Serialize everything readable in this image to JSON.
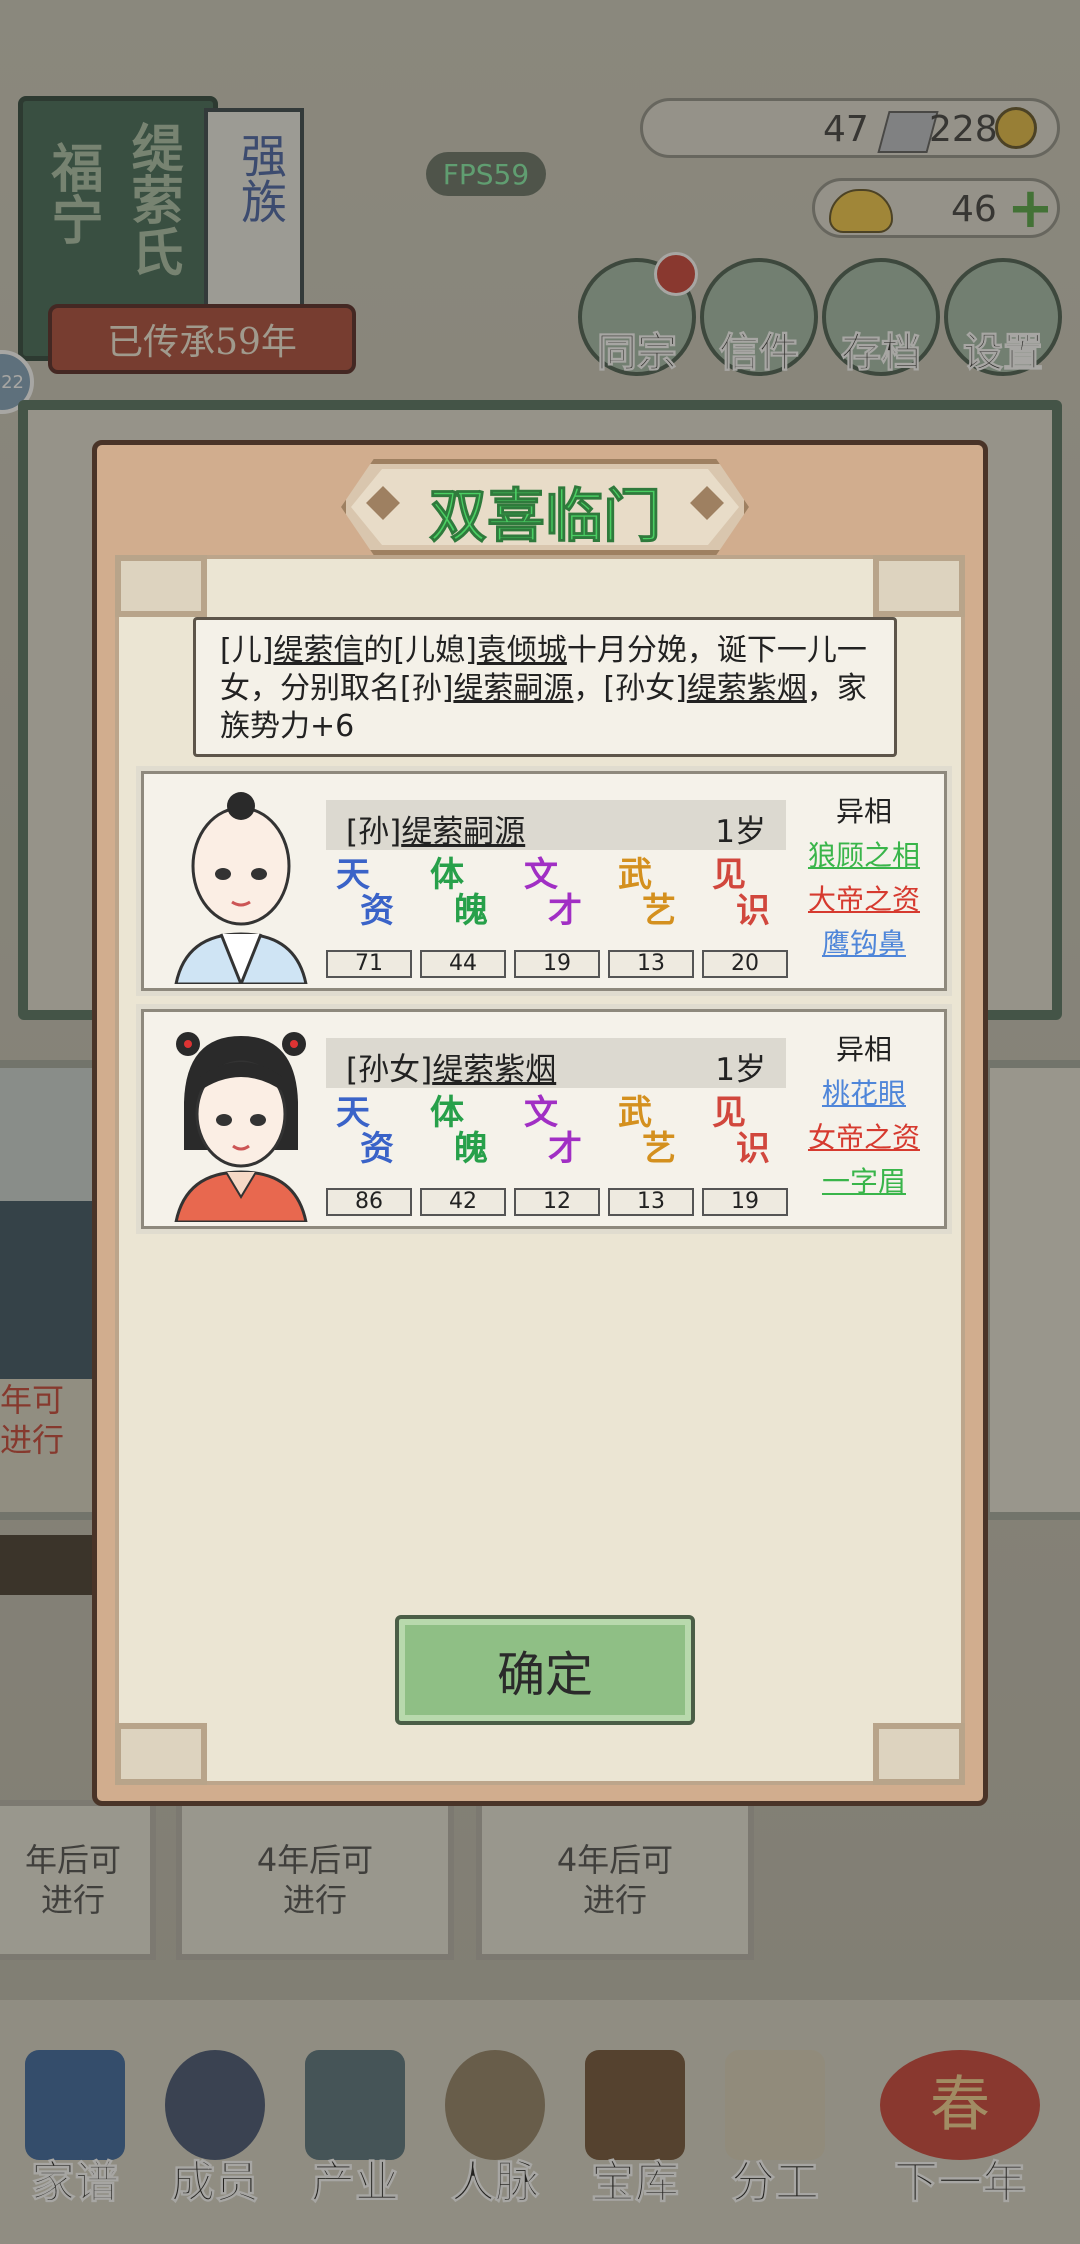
{
  "background": {
    "clan": {
      "book_chars_1": "福宁",
      "book_chars_2": "缇萦氏",
      "side_label": "强族",
      "generations": "已传承59年"
    },
    "avatar_badge": "22",
    "fps": "FPS59",
    "resources": {
      "silver": "47",
      "copper": "228",
      "gold": "46"
    },
    "top_buttons": [
      "同宗",
      "信件",
      "存档",
      "设置"
    ],
    "mid_text": "年可\n进行",
    "lower_cards": [
      "年后可\n进行",
      "4年后可\n进行",
      "4年后可\n进行"
    ],
    "nav": [
      "家谱",
      "成员",
      "产业",
      "人脉",
      "宝库",
      "分工",
      "下一年"
    ],
    "spring_char": "春"
  },
  "modal": {
    "title": "双喜临门",
    "message": {
      "p1": "[儿]",
      "father": "缇萦信",
      "p2": "的[儿媳]",
      "mother": "袁倾城",
      "p3": "十月分娩，诞下一儿一女，分别取名[孙]",
      "son": "缇萦嗣源",
      "p4": "，[孙女]",
      "daughter": "缇萦紫烟",
      "p5": "，家族势力+6"
    },
    "children": [
      {
        "prefix": "[孙]",
        "name": "缇萦嗣源",
        "age": "1岁",
        "stats": [
          {
            "c1": "天",
            "c2": "资",
            "value": "71",
            "color": "#3a63c8"
          },
          {
            "c1": "体",
            "c2": "魄",
            "value": "44",
            "color": "#27a04a"
          },
          {
            "c1": "文",
            "c2": "才",
            "value": "19",
            "color": "#a12fc4"
          },
          {
            "c1": "武",
            "c2": "艺",
            "value": "13",
            "color": "#d4901e"
          },
          {
            "c1": "见",
            "c2": "识",
            "value": "20",
            "color": "#d1473d"
          }
        ],
        "traits_header": "异相",
        "traits": [
          {
            "label": "狼顾之相",
            "color": "#39b54a"
          },
          {
            "label": "大帝之资",
            "color": "#d63a2f"
          },
          {
            "label": "鹰钩鼻",
            "color": "#4f86d9"
          }
        ]
      },
      {
        "prefix": "[孙女]",
        "name": "缇萦紫烟",
        "age": "1岁",
        "stats": [
          {
            "c1": "天",
            "c2": "资",
            "value": "86",
            "color": "#3a63c8"
          },
          {
            "c1": "体",
            "c2": "魄",
            "value": "42",
            "color": "#27a04a"
          },
          {
            "c1": "文",
            "c2": "才",
            "value": "12",
            "color": "#a12fc4"
          },
          {
            "c1": "武",
            "c2": "艺",
            "value": "13",
            "color": "#d4901e"
          },
          {
            "c1": "见",
            "c2": "识",
            "value": "19",
            "color": "#d1473d"
          }
        ],
        "traits_header": "异相",
        "traits": [
          {
            "label": "桃花眼",
            "color": "#4f86d9"
          },
          {
            "label": "女帝之资",
            "color": "#d63a2f"
          },
          {
            "label": "一字眉",
            "color": "#39b54a"
          }
        ]
      }
    ],
    "confirm_label": "确定"
  }
}
